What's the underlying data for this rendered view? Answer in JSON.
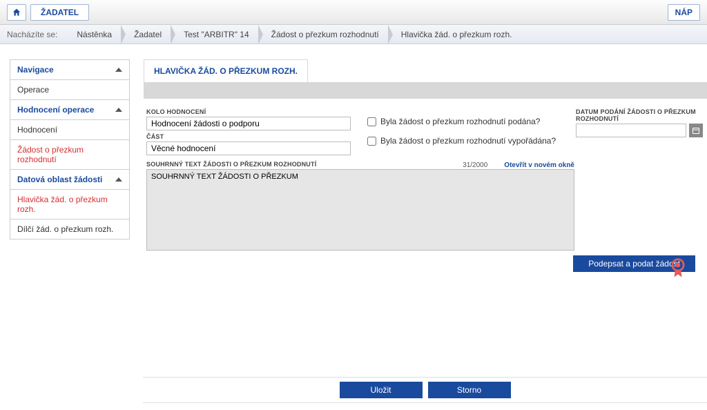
{
  "header": {
    "tab_label": "ŽADATEL",
    "right_button": "NÁP"
  },
  "breadcrumb": {
    "label": "Nacházíte se:",
    "items": [
      "Nástěnka",
      "Žadatel",
      "Test \"ARBITR\" 14",
      "Žádost o přezkum rozhodnutí",
      "Hlavička žád. o přezkum rozh."
    ]
  },
  "sidebar": {
    "sections": [
      {
        "title": "Navigace",
        "items": [
          {
            "label": "Operace",
            "red": false
          }
        ]
      },
      {
        "title": "Hodnocení operace",
        "items": [
          {
            "label": "Hodnocení",
            "red": false
          },
          {
            "label": "Žádost o přezkum rozhodnutí",
            "red": true
          }
        ]
      },
      {
        "title": "Datová oblast žádosti",
        "items": [
          {
            "label": "Hlavička žád. o přezkum rozh.",
            "red": true
          },
          {
            "label": "Dílčí žád. o přezkum rozh.",
            "red": false
          }
        ]
      }
    ]
  },
  "main": {
    "panel_title": "HLAVIČKA ŽÁD. O PŘEZKUM ROZH.",
    "kolo_label": "KOLO HODNOCENÍ",
    "kolo_value": "Hodnocení žádosti o podporu",
    "cast_label": "ČÁST",
    "cast_value": "Věcné hodnocení",
    "check1_label": "Byla žádost o přezkum rozhodnutí podána?",
    "check2_label": "Byla žádost o přezkum rozhodnutí vypořádána?",
    "date_label": "DATUM PODÁNÍ ŽÁDOSTI O PŘEZKUM ROZHODNUTÍ",
    "date_value": "",
    "text_label": "SOUHRNNÝ TEXT ŽÁDOSTI O PŘEZKUM ROZHODNUTÍ",
    "text_value": "SOUHRNNÝ TEXT ŽÁDOSTI O PŘEZKUM",
    "counter": "31/2000",
    "open_link": "Otevřít v novém okně",
    "sign_button": "Podepsat a podat žádost"
  },
  "footer": {
    "save": "Uložit",
    "cancel": "Storno"
  }
}
